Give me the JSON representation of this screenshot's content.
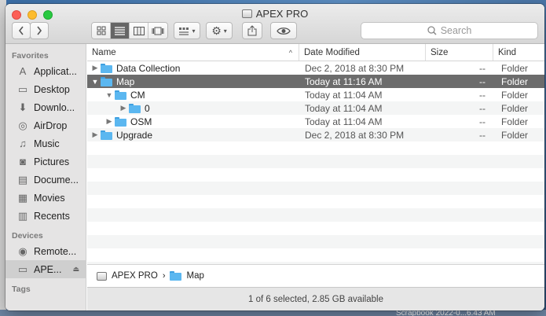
{
  "window": {
    "title": "APEX PRO"
  },
  "toolbar": {
    "back_icon": "chevron-left-icon",
    "forward_icon": "chevron-right-icon",
    "search_placeholder": "Search"
  },
  "sidebar": {
    "favorites_header": "Favorites",
    "favorites": [
      {
        "label": "Applicat...",
        "icon": "applications-icon"
      },
      {
        "label": "Desktop",
        "icon": "desktop-icon"
      },
      {
        "label": "Downlo...",
        "icon": "downloads-icon"
      },
      {
        "label": "AirDrop",
        "icon": "airdrop-icon"
      },
      {
        "label": "Music",
        "icon": "music-icon"
      },
      {
        "label": "Pictures",
        "icon": "camera-icon"
      },
      {
        "label": "Docume...",
        "icon": "documents-icon"
      },
      {
        "label": "Movies",
        "icon": "film-icon"
      },
      {
        "label": "Recents",
        "icon": "recents-icon"
      }
    ],
    "devices_header": "Devices",
    "devices": [
      {
        "label": "Remote...",
        "icon": "disc-icon"
      },
      {
        "label": "APE...",
        "icon": "drive-icon"
      }
    ],
    "tags_header": "Tags"
  },
  "columns": {
    "name": "Name",
    "date": "Date Modified",
    "size": "Size",
    "kind": "Kind"
  },
  "files": [
    {
      "name": "Data Collection",
      "date": "Dec 2, 2018 at 8:30 PM",
      "size": "--",
      "kind": "Folder"
    },
    {
      "name": "Map",
      "date": "Today at 11:16 AM",
      "size": "--",
      "kind": "Folder"
    },
    {
      "name": "CM",
      "date": "Today at 11:04 AM",
      "size": "--",
      "kind": "Folder"
    },
    {
      "name": "0",
      "date": "Today at 11:04 AM",
      "size": "--",
      "kind": "Folder"
    },
    {
      "name": "OSM",
      "date": "Today at 11:04 AM",
      "size": "--",
      "kind": "Folder"
    },
    {
      "name": "Upgrade",
      "date": "Dec 2, 2018 at 8:30 PM",
      "size": "--",
      "kind": "Folder"
    }
  ],
  "pathbar": {
    "root": "APEX PRO",
    "current": "Map"
  },
  "status": "1 of 6 selected, 2.85 GB available",
  "desktop": {
    "label": "Scrapbook     2022-0...6.43 AM"
  },
  "colors": {
    "selection": "#6c6c6c",
    "folder": "#5bb7f0",
    "close": "#fc5f57",
    "minimize": "#fdbc2e",
    "maximize": "#28c940"
  }
}
